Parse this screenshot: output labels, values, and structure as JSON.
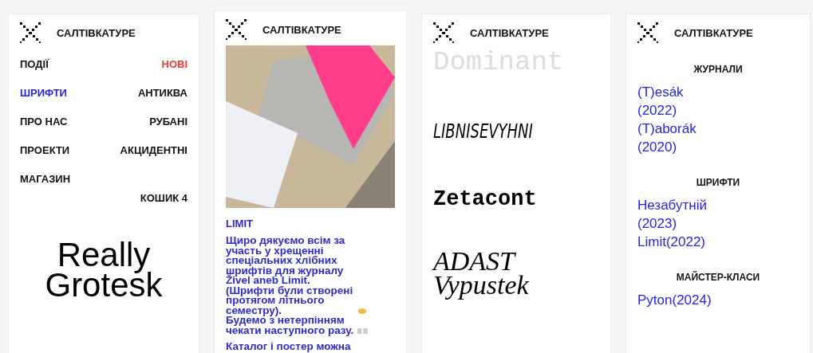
{
  "screens": [
    {
      "brand": "САЛТІВКАТУРЕ",
      "kind": "menu",
      "menu_left": [
        {
          "label": "ПОДІЇ",
          "selected": false
        },
        {
          "label": "ШРИФТИ",
          "selected": true
        },
        {
          "label": "ПРО НАС",
          "selected": false
        },
        {
          "label": "ПРОЕКТИ",
          "selected": false
        },
        {
          "label": "МАГАЗИН",
          "selected": false
        }
      ],
      "menu_right": [
        {
          "label": "НОВІ",
          "color": "#f03b33"
        },
        {
          "label": "АНТИКВА",
          "color": "#111111"
        },
        {
          "label": "РУБАНІ",
          "color": "#111111"
        },
        {
          "label": "АКЦИДЕНТНІ",
          "color": "#111111"
        }
      ],
      "cart": "КОШИК 4",
      "specimen": "Really Grotesk"
    },
    {
      "brand": "САЛТІВКАТУРЕ",
      "kind": "post",
      "title": "LIMIT",
      "paragraphs": [
        {
          "text": "Щиро дякуємо всім за участь у хрещенні спеціальних хлібних шрифтів для журналу Živel aneb Limit.",
          "kind": "plain"
        },
        {
          "text": "(Шрифти були створені протягом літнього семестру).",
          "kind": "handshake"
        },
        {
          "text": "Будемо з нетерпінням чекати наступного разу.",
          "kind": "book"
        },
        {
          "text": "Каталог і постер можна",
          "kind": "plain"
        }
      ]
    },
    {
      "brand": "САЛТІВКАТУРЕ",
      "kind": "fonts",
      "fonts": [
        {
          "name": "Dominant",
          "kind": "light"
        },
        {
          "name": "LIBNISEVYHNI",
          "kind": "condensed"
        },
        {
          "name": "Zetacont",
          "kind": "heavy"
        },
        {
          "name": "ADAST Vypustek",
          "kind": "script"
        }
      ]
    },
    {
      "brand": "САЛТІВКАТУРЕ",
      "kind": "archive",
      "sections": [
        {
          "heading": "ЖУРНАЛИ",
          "links": [
            "(T)esák (2022)",
            "(T)aborák (2020)"
          ]
        },
        {
          "heading": "ШРИФТИ",
          "links": [
            "Незабутній (2023)",
            "Limit(2022)"
          ]
        },
        {
          "heading": "МАЙСТЕР-КЛАСИ",
          "links": [
            "Pyton(2024)"
          ]
        }
      ]
    }
  ]
}
